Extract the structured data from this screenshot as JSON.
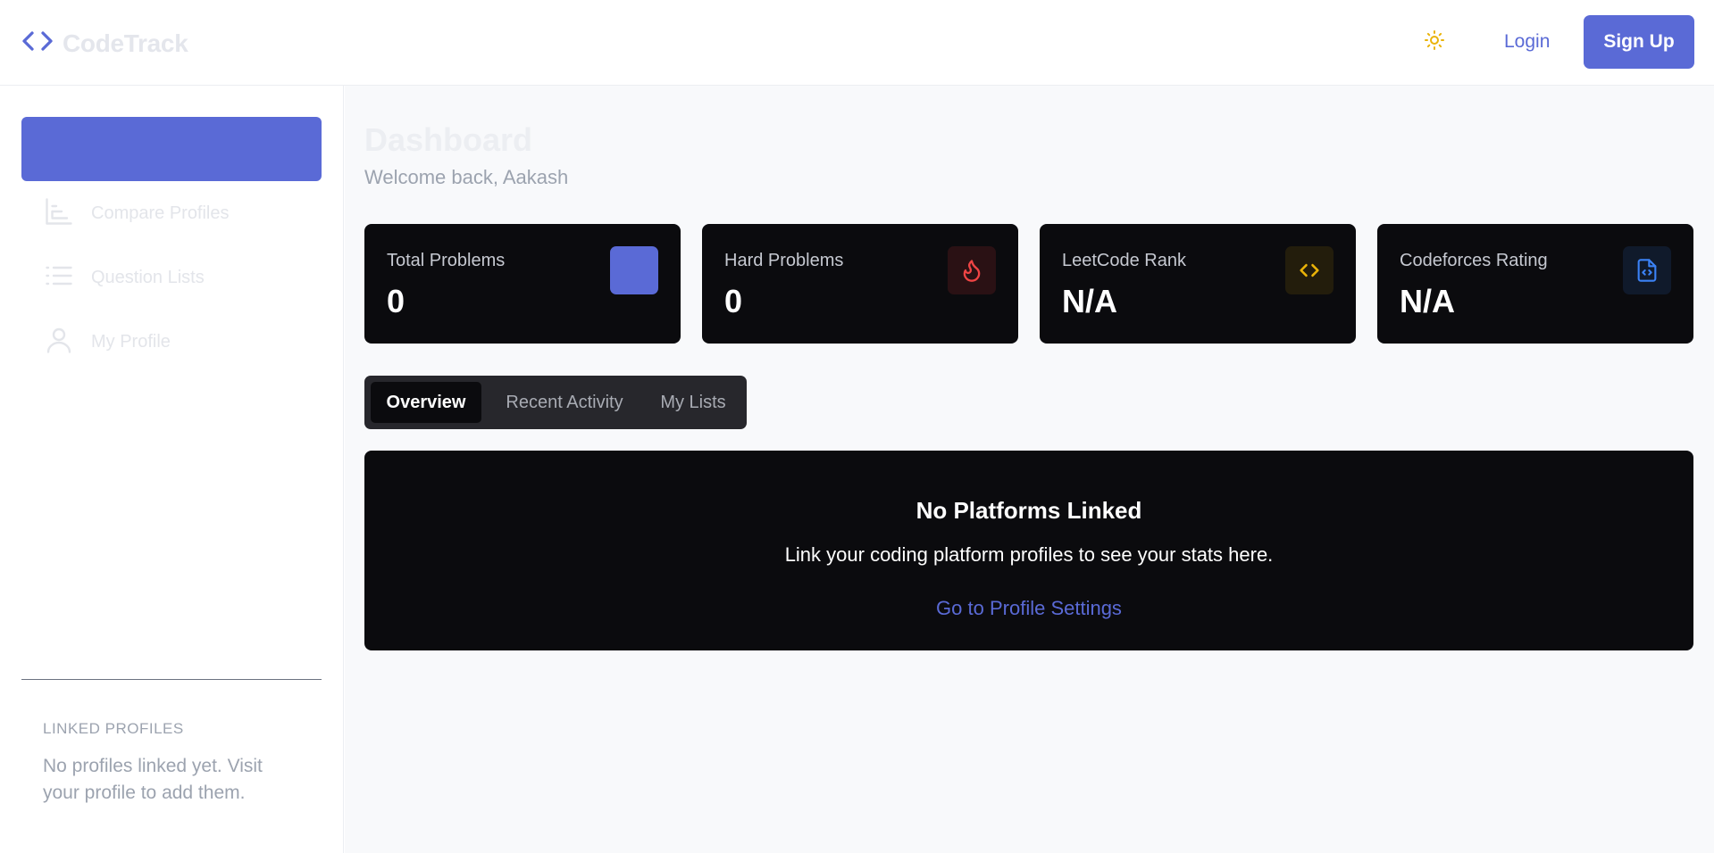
{
  "brand": {
    "name": "CodeTrack",
    "icon": "code-brackets-icon"
  },
  "header": {
    "theme_icon": "sun-icon",
    "login_label": "Login",
    "signup_label": "Sign Up"
  },
  "sidebar": {
    "items": [
      {
        "label": "Compare Profiles",
        "icon": "bar-chart-icon"
      },
      {
        "label": "Question Lists",
        "icon": "list-icon"
      },
      {
        "label": "My Profile",
        "icon": "user-icon"
      }
    ],
    "linked_title": "LINKED PROFILES",
    "linked_text": "No profiles linked yet. Visit your profile to add them."
  },
  "main": {
    "title": "Dashboard",
    "welcome": "Welcome back, Aakash",
    "stats": [
      {
        "label": "Total Problems",
        "value": "0",
        "icon": "blank-square-icon",
        "color": "#5a6ad6"
      },
      {
        "label": "Hard Problems",
        "value": "0",
        "icon": "flame-icon",
        "color": "#ef4444"
      },
      {
        "label": "LeetCode Rank",
        "value": "N/A",
        "icon": "code-icon",
        "color": "#eab308"
      },
      {
        "label": "Codeforces Rating",
        "value": "N/A",
        "icon": "code-file-icon",
        "color": "#3b82f6"
      }
    ],
    "tabs": [
      {
        "label": "Overview",
        "active": true
      },
      {
        "label": "Recent Activity",
        "active": false
      },
      {
        "label": "My Lists",
        "active": false
      }
    ],
    "empty_state": {
      "title": "No Platforms Linked",
      "text": "Link your coding platform profiles to see your stats here.",
      "link": "Go to Profile Settings"
    }
  },
  "colors": {
    "accent": "#5a6ad6",
    "card_bg": "#0b0b0e",
    "main_bg": "#f8f9fb"
  }
}
